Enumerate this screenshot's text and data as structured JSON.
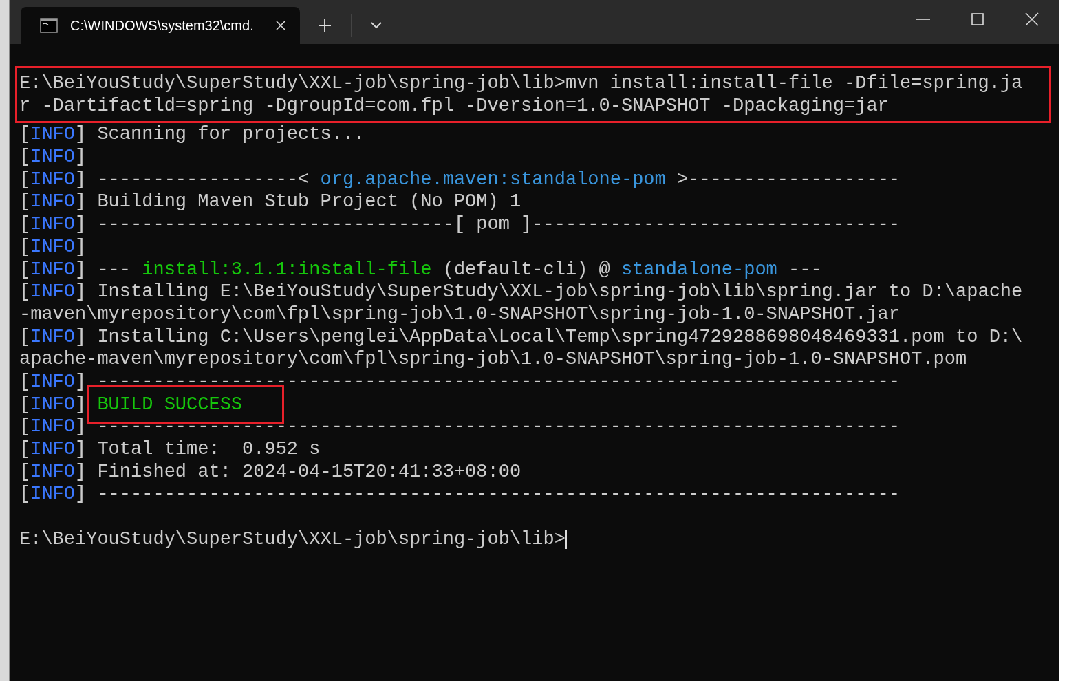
{
  "window": {
    "tab_title": "C:\\WINDOWS\\system32\\cmd."
  },
  "command": {
    "highlighted": true,
    "lines": [
      [
        {
          "kind": "plain",
          "text": "E:\\BeiYouStudy\\SuperStudy\\XXL-job\\spring-job\\lib>mvn install:install-file -Dfile=spring.ja"
        }
      ],
      [
        {
          "kind": "plain",
          "text": "r -Dartifactld=spring -DgroupId=com.fpl -Dversion=1.0-SNAPSHOT -Dpackaging=jar"
        }
      ]
    ]
  },
  "output": [
    [
      {
        "kind": "plain",
        "text": "["
      },
      {
        "kind": "level",
        "text": "INFO"
      },
      {
        "kind": "plain",
        "text": "] Scanning for projects..."
      }
    ],
    [
      {
        "kind": "plain",
        "text": "["
      },
      {
        "kind": "level",
        "text": "INFO"
      },
      {
        "kind": "plain",
        "text": "]"
      }
    ],
    [
      {
        "kind": "plain",
        "text": "["
      },
      {
        "kind": "level",
        "text": "INFO"
      },
      {
        "kind": "plain",
        "text": "] ------------------< "
      },
      {
        "kind": "artifact",
        "text": "org.apache.maven:standalone-pom"
      },
      {
        "kind": "plain",
        "text": " >-------------------"
      }
    ],
    [
      {
        "kind": "plain",
        "text": "["
      },
      {
        "kind": "level",
        "text": "INFO"
      },
      {
        "kind": "plain",
        "text": "] Building Maven Stub Project (No POM) 1"
      }
    ],
    [
      {
        "kind": "plain",
        "text": "["
      },
      {
        "kind": "level",
        "text": "INFO"
      },
      {
        "kind": "plain",
        "text": "] --------------------------------[ pom ]---------------------------------"
      }
    ],
    [
      {
        "kind": "plain",
        "text": "["
      },
      {
        "kind": "level",
        "text": "INFO"
      },
      {
        "kind": "plain",
        "text": "]"
      }
    ],
    [
      {
        "kind": "plain",
        "text": "["
      },
      {
        "kind": "level",
        "text": "INFO"
      },
      {
        "kind": "plain",
        "text": "] --- "
      },
      {
        "kind": "goal",
        "text": "install:3.1.1:install-file"
      },
      {
        "kind": "plain",
        "text": " (default-cli) @ "
      },
      {
        "kind": "artifact",
        "text": "standalone-pom"
      },
      {
        "kind": "plain",
        "text": " ---"
      }
    ],
    [
      {
        "kind": "plain",
        "text": "["
      },
      {
        "kind": "level",
        "text": "INFO"
      },
      {
        "kind": "plain",
        "text": "] Installing E:\\BeiYouStudy\\SuperStudy\\XXL-job\\spring-job\\lib\\spring.jar to D:\\apache"
      }
    ],
    [
      {
        "kind": "plain",
        "text": "-maven\\myrepository\\com\\fpl\\spring-job\\1.0-SNAPSHOT\\spring-job-1.0-SNAPSHOT.jar"
      }
    ],
    [
      {
        "kind": "plain",
        "text": "["
      },
      {
        "kind": "level",
        "text": "INFO"
      },
      {
        "kind": "plain",
        "text": "] Installing C:\\Users\\penglei\\AppData\\Local\\Temp\\spring4729288698048469331.pom to D:\\"
      }
    ],
    [
      {
        "kind": "plain",
        "text": "apache-maven\\myrepository\\com\\fpl\\spring-job\\1.0-SNAPSHOT\\spring-job-1.0-SNAPSHOT.pom"
      }
    ],
    [
      {
        "kind": "plain",
        "text": "["
      },
      {
        "kind": "level",
        "text": "INFO"
      },
      {
        "kind": "plain",
        "text": "] ------------------------------------------------------------------------"
      }
    ],
    [
      {
        "kind": "plain",
        "text": "["
      },
      {
        "kind": "level",
        "text": "INFO"
      },
      {
        "kind": "plain",
        "text": "] "
      },
      {
        "kind": "success",
        "text": "BUILD SUCCESS",
        "highlighted": true
      }
    ],
    [
      {
        "kind": "plain",
        "text": "["
      },
      {
        "kind": "level",
        "text": "INFO"
      },
      {
        "kind": "plain",
        "text": "] ------------------------------------------------------------------------"
      }
    ],
    [
      {
        "kind": "plain",
        "text": "["
      },
      {
        "kind": "level",
        "text": "INFO"
      },
      {
        "kind": "plain",
        "text": "] Total time:  0.952 s"
      }
    ],
    [
      {
        "kind": "plain",
        "text": "["
      },
      {
        "kind": "level",
        "text": "INFO"
      },
      {
        "kind": "plain",
        "text": "] Finished at: 2024-04-15T20:41:33+08:00"
      }
    ],
    [
      {
        "kind": "plain",
        "text": "["
      },
      {
        "kind": "level",
        "text": "INFO"
      },
      {
        "kind": "plain",
        "text": "] ------------------------------------------------------------------------"
      }
    ]
  ],
  "prompt": [
    {
      "kind": "plain",
      "text": "E:\\BeiYouStudy\\SuperStudy\\XXL-job\\spring-job\\lib>"
    }
  ],
  "cursor": true
}
